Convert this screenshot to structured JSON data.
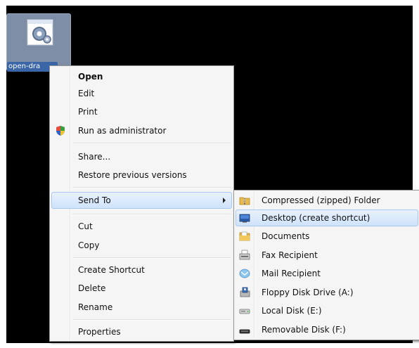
{
  "desktop_icon": {
    "label": "open-dra",
    "icon": "settings-file-icon"
  },
  "context_menu": {
    "items": [
      {
        "label": "Open",
        "bold": true
      },
      {
        "label": "Edit"
      },
      {
        "label": "Print"
      },
      {
        "label": "Run as administrator",
        "icon": "uac-shield-icon"
      },
      {
        "label": "Share..."
      },
      {
        "label": "Restore previous versions"
      },
      {
        "label": "Send To",
        "has_submenu": true,
        "highlighted": true
      },
      {
        "label": "Cut"
      },
      {
        "label": "Copy"
      },
      {
        "label": "Create Shortcut"
      },
      {
        "label": "Delete"
      },
      {
        "label": "Rename"
      },
      {
        "label": "Properties"
      }
    ]
  },
  "send_to_menu": {
    "items": [
      {
        "label": "Compressed (zipped) Folder",
        "icon": "zip-folder-icon"
      },
      {
        "label": "Desktop (create shortcut)",
        "icon": "desktop-icon",
        "highlighted": true
      },
      {
        "label": "Documents",
        "icon": "documents-folder-icon"
      },
      {
        "label": "Fax Recipient",
        "icon": "fax-icon"
      },
      {
        "label": "Mail Recipient",
        "icon": "mail-icon"
      },
      {
        "label": "Floppy Disk Drive (A:)",
        "icon": "floppy-drive-icon"
      },
      {
        "label": "Local Disk (E:)",
        "icon": "hard-disk-icon"
      },
      {
        "label": "Removable Disk (F:)",
        "icon": "removable-disk-icon"
      }
    ]
  },
  "colors": {
    "desktop": "#000000",
    "menu_bg": "#f5f5f5",
    "highlight": "#cfe3fb",
    "icon_label_bg": "#3a66a8"
  }
}
